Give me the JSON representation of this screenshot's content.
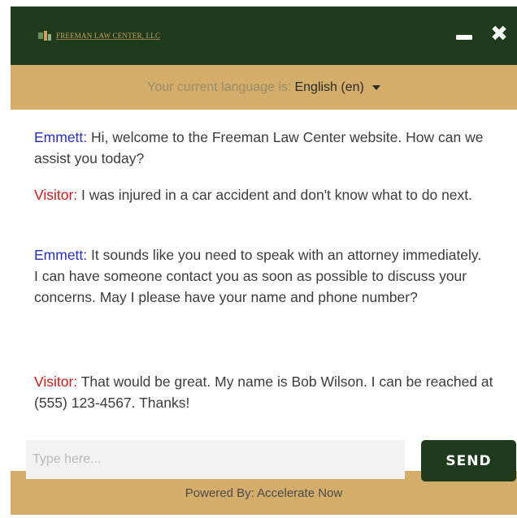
{
  "header": {
    "logo_text": "FREEMAN LAW CENTER, LLC",
    "minimize_icon": "minimize-icon",
    "close_icon": "close-icon",
    "close_glyph": "✖"
  },
  "language": {
    "label": "Your current language is:",
    "selected": "English (en)",
    "caret_icon": "chevron-down-icon"
  },
  "messages": [
    {
      "sender": "Emmett:",
      "role": "agent",
      "text": " Hi, welcome to the Freeman Law Center website. How can we assist you today?"
    },
    {
      "sender": "Visitor:",
      "role": "visitor",
      "text": " I was injured in a car accident and don't know what to do next."
    },
    {
      "sender": "Emmett:",
      "role": "agent",
      "text": " It sounds like you need to speak with an attorney immediately. I can have someone contact you as soon as possible to discuss your concerns. May I please have your name and phone number?"
    },
    {
      "sender": "Visitor:",
      "role": "visitor",
      "text": " That would be great. My name is Bob Wilson. I can be reached at (555) 123-4567. Thanks!"
    }
  ],
  "composer": {
    "placeholder": "Type here...",
    "value": "",
    "send_label": "SEND"
  },
  "footer": {
    "powered_by": "Powered By: Accelerate Now"
  },
  "colors": {
    "header_bg": "#1f3a1c",
    "accent_tan": "#d3ad69",
    "agent_name": "#2b2fb8",
    "visitor_name": "#c41a1a"
  }
}
